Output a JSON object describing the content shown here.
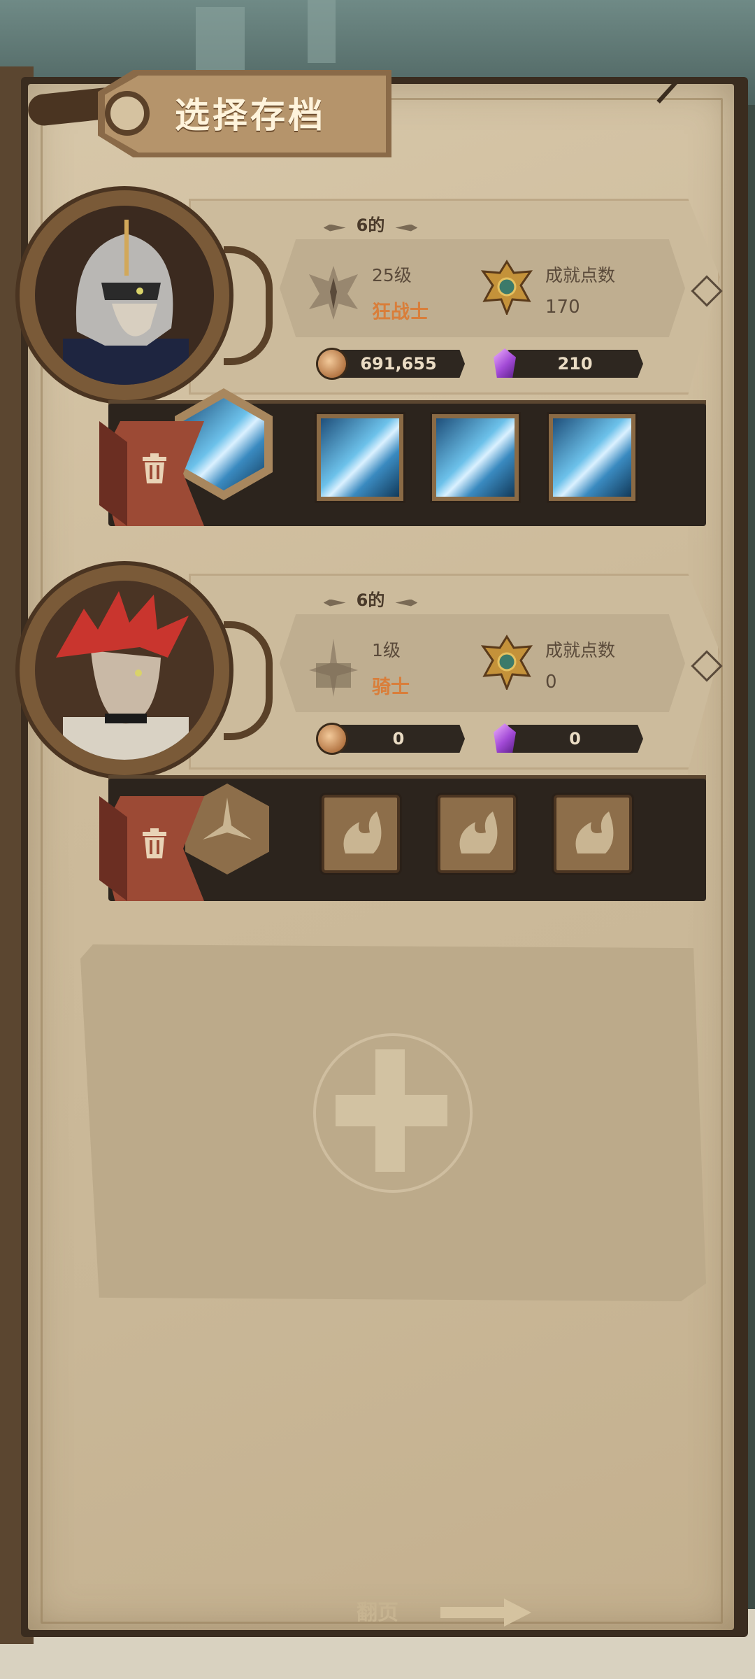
{
  "header": {
    "title": "选择存档"
  },
  "saves": [
    {
      "slot_label": "6的",
      "level": "25级",
      "class_name": "狂战士",
      "achievement_label": "成就点数",
      "achievement_points": "170",
      "gold": "691,655",
      "gems": "210",
      "skills_unlocked": true
    },
    {
      "slot_label": "6的",
      "level": "1级",
      "class_name": "骑士",
      "achievement_label": "成就点数",
      "achievement_points": "0",
      "gold": "0",
      "gems": "0",
      "skills_unlocked": false
    }
  ],
  "footer": {
    "page_turn_label": "翻页"
  },
  "colors": {
    "accent": "#d97e3a",
    "page": "#cdbb9b",
    "panel": "#2c241d"
  }
}
